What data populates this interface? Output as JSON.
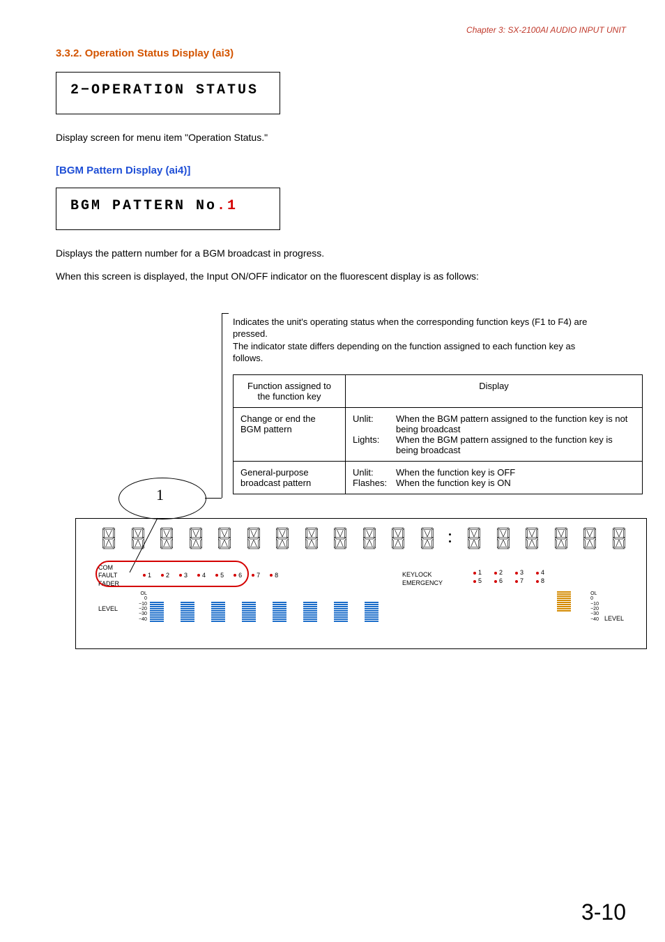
{
  "chapter": "Chapter 3: SX-2100AI AUDIO INPUT UNIT",
  "sect_num_title": "3.3.2. Operation Status Display (ai3)",
  "lcd1": "2−OPERATION STATUS",
  "body1": "Display screen for menu item \"Operation Status.\"",
  "sub1": "[BGM Pattern Display (ai4)]",
  "lcd2_prefix": "BGM PATTERN No",
  "lcd2_dot": ".",
  "lcd2_num": "1",
  "body2": "Displays the pattern number for a BGM broadcast in progress.",
  "body3": "When this screen is displayed, the Input ON/OFF indicator on the fluorescent display is as follows:",
  "callout": "Indicates the unit's operating status when the corresponding function keys (F1 to F4) are pressed.\nThe indicator state differs depending on the function assigned to each function key as follows.",
  "table": {
    "h1": "Function assigned to the function key",
    "h2": "Display",
    "r1c1": "Change or end the BGM pattern",
    "r1_unlit_lab": "Unlit:",
    "r1_unlit": "When the BGM pattern assigned to the function key is not being broadcast",
    "r1_lights_lab": "Lights:",
    "r1_lights": "When the BGM pattern assigned to the function key is being broadcast",
    "r2c1": "General-purpose broadcast pattern",
    "r2_unlit_lab": "Unlit:",
    "r2_unlit": "When the function key is OFF",
    "r2_flash_lab": "Flashes:",
    "r2_flash": "When the function key is ON"
  },
  "callout_num": "1",
  "panel": {
    "com": "COM",
    "fault": "FAULT",
    "fader": "FADER",
    "level_l": "LEVEL",
    "level_r": "LEVEL",
    "keylock": "KEYLOCK",
    "emergency": "EMERGENCY",
    "nums": [
      "1",
      "2",
      "3",
      "4",
      "5",
      "6",
      "7",
      "8"
    ],
    "rnums_top": [
      "1",
      "2",
      "3",
      "4"
    ],
    "rnums_bot": [
      "5",
      "6",
      "7",
      "8"
    ],
    "scale": [
      "OL",
      "0",
      "−10",
      "−20",
      "−30",
      "−40"
    ]
  },
  "pagenum": "3-10"
}
